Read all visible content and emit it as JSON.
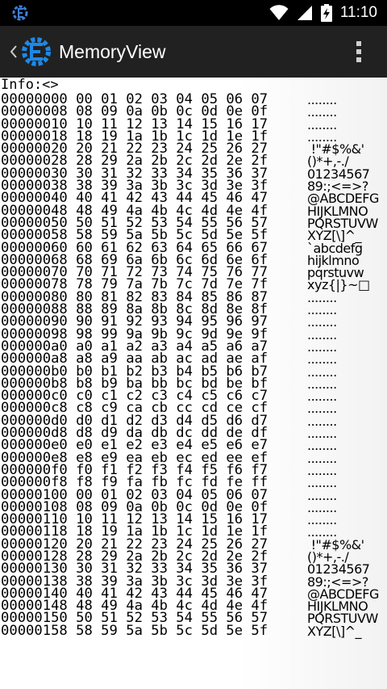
{
  "status_bar": {
    "time": "11:10",
    "icons": [
      "cheat-engine-notification-icon",
      "wifi-icon",
      "signal-icon",
      "battery-charging-icon"
    ]
  },
  "app_bar": {
    "title": "MemoryView",
    "icons": [
      "back-chevron-icon",
      "cheat-engine-logo-icon",
      "overflow-menu-icon"
    ]
  },
  "info_label": "Info:<>",
  "memory_rows": [
    {
      "hex": "00000000 00 01 02 03 04 05 06 07",
      "ascii": "........"
    },
    {
      "hex": "00000008 08 09 0a 0b 0c 0d 0e 0f",
      "ascii": "........"
    },
    {
      "hex": "00000010 10 11 12 13 14 15 16 17",
      "ascii": "........"
    },
    {
      "hex": "00000018 18 19 1a 1b 1c 1d 1e 1f",
      "ascii": "........"
    },
    {
      "hex": "00000020 20 21 22 23 24 25 26 27",
      "ascii": " !\"#$%&'"
    },
    {
      "hex": "00000028 28 29 2a 2b 2c 2d 2e 2f",
      "ascii": "()*+,-./"
    },
    {
      "hex": "00000030 30 31 32 33 34 35 36 37",
      "ascii": "01234567"
    },
    {
      "hex": "00000038 38 39 3a 3b 3c 3d 3e 3f",
      "ascii": "89:;<=>?"
    },
    {
      "hex": "00000040 40 41 42 43 44 45 46 47",
      "ascii": "@ABCDEFG"
    },
    {
      "hex": "00000048 48 49 4a 4b 4c 4d 4e 4f",
      "ascii": "HIJKLMNO"
    },
    {
      "hex": "00000050 50 51 52 53 54 55 56 57",
      "ascii": "PQRSTUVW"
    },
    {
      "hex": "00000058 58 59 5a 5b 5c 5d 5e 5f",
      "ascii": "XYZ[\\]^_"
    },
    {
      "hex": "00000060 60 61 62 63 64 65 66 67",
      "ascii": "`abcdefg"
    },
    {
      "hex": "00000068 68 69 6a 6b 6c 6d 6e 6f",
      "ascii": "hijklmno"
    },
    {
      "hex": "00000070 70 71 72 73 74 75 76 77",
      "ascii": "pqrstuvw"
    },
    {
      "hex": "00000078 78 79 7a 7b 7c 7d 7e 7f",
      "ascii": "xyz{|}~□"
    },
    {
      "hex": "00000080 80 81 82 83 84 85 86 87",
      "ascii": "........"
    },
    {
      "hex": "00000088 88 89 8a 8b 8c 8d 8e 8f",
      "ascii": "........"
    },
    {
      "hex": "00000090 90 91 92 93 94 95 96 97",
      "ascii": "........"
    },
    {
      "hex": "00000098 98 99 9a 9b 9c 9d 9e 9f",
      "ascii": "........"
    },
    {
      "hex": "000000a0 a0 a1 a2 a3 a4 a5 a6 a7",
      "ascii": "........"
    },
    {
      "hex": "000000a8 a8 a9 aa ab ac ad ae af",
      "ascii": "........"
    },
    {
      "hex": "000000b0 b0 b1 b2 b3 b4 b5 b6 b7",
      "ascii": "........"
    },
    {
      "hex": "000000b8 b8 b9 ba bb bc bd be bf",
      "ascii": "........"
    },
    {
      "hex": "000000c0 c0 c1 c2 c3 c4 c5 c6 c7",
      "ascii": "........"
    },
    {
      "hex": "000000c8 c8 c9 ca cb cc cd ce cf",
      "ascii": "........"
    },
    {
      "hex": "000000d0 d0 d1 d2 d3 d4 d5 d6 d7",
      "ascii": "........"
    },
    {
      "hex": "000000d8 d8 d9 da db dc dd de df",
      "ascii": "........"
    },
    {
      "hex": "000000e0 e0 e1 e2 e3 e4 e5 e6 e7",
      "ascii": "........"
    },
    {
      "hex": "000000e8 e8 e9 ea eb ec ed ee ef",
      "ascii": "........"
    },
    {
      "hex": "000000f0 f0 f1 f2 f3 f4 f5 f6 f7",
      "ascii": "........"
    },
    {
      "hex": "000000f8 f8 f9 fa fb fc fd fe ff",
      "ascii": "........"
    },
    {
      "hex": "00000100 00 01 02 03 04 05 06 07",
      "ascii": "........"
    },
    {
      "hex": "00000108 08 09 0a 0b 0c 0d 0e 0f",
      "ascii": "........"
    },
    {
      "hex": "00000110 10 11 12 13 14 15 16 17",
      "ascii": "........"
    },
    {
      "hex": "00000118 18 19 1a 1b 1c 1d 1e 1f",
      "ascii": "........"
    },
    {
      "hex": "00000120 20 21 22 23 24 25 26 27",
      "ascii": " !\"#$%&'"
    },
    {
      "hex": "00000128 28 29 2a 2b 2c 2d 2e 2f",
      "ascii": "()*+,-./"
    },
    {
      "hex": "00000130 30 31 32 33 34 35 36 37",
      "ascii": "01234567"
    },
    {
      "hex": "00000138 38 39 3a 3b 3c 3d 3e 3f",
      "ascii": "89:;<=>?"
    },
    {
      "hex": "00000140 40 41 42 43 44 45 46 47",
      "ascii": "@ABCDEFG"
    },
    {
      "hex": "00000148 48 49 4a 4b 4c 4d 4e 4f",
      "ascii": "HIJKLMNO"
    },
    {
      "hex": "00000150 50 51 52 53 54 55 56 57",
      "ascii": "PQRSTUVW"
    },
    {
      "hex": "00000158 58 59 5a 5b 5c 5d 5e 5f",
      "ascii": "XYZ[\\]^_"
    }
  ],
  "colors": {
    "status_bar_bg": "#000000",
    "app_bar_bg": "#212121",
    "logo_blue": "#1e88e5",
    "content_bg": "#ffffff",
    "text": "#000000"
  }
}
